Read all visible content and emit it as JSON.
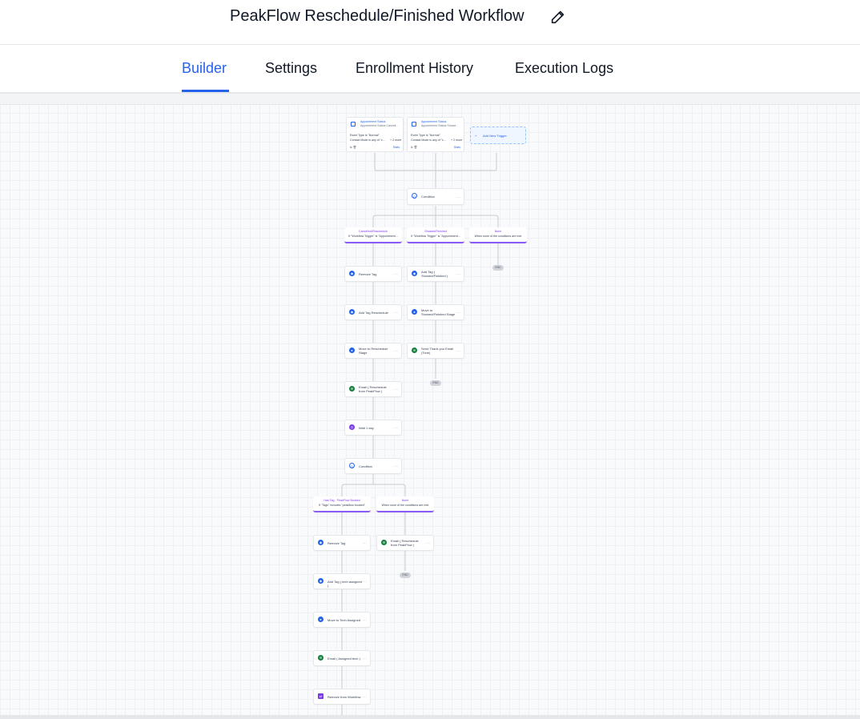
{
  "header": {
    "title": "PeakFlow Reschedule/Finished Workflow",
    "edit_icon": "pencil-icon"
  },
  "tabs": [
    {
      "label": "Builder",
      "active": true
    },
    {
      "label": "Settings",
      "active": false
    },
    {
      "label": "Enrollment History",
      "active": false
    },
    {
      "label": "Execution Logs",
      "active": false
    }
  ],
  "colors": {
    "accent": "#2563eb",
    "branch": "#8b5cf6",
    "email": "#15803d"
  },
  "triggers": [
    {
      "title": "Appointment Status",
      "subtitle": "Appointment Status Cancell...",
      "line1": "Event Type is \"Normal\"",
      "line2": "Contact Mode is any of \"c...",
      "more": "+ 2 more",
      "stats": "Stats"
    },
    {
      "title": "Appointment Status",
      "subtitle": "Appointment Status Showe...",
      "line1": "Event Type is \"Normal\"",
      "line2": "Contact Mode is any of \"c...",
      "more": "+ 2 more",
      "stats": "Stats"
    }
  ],
  "add_trigger": "Add New Trigger",
  "conditions": {
    "first": "Condition",
    "second": "Condition"
  },
  "branches": {
    "cancelled": {
      "title": "Cancelled/Reschedule",
      "desc": "If \"Workflow Trigger\" is \"Appointment..."
    },
    "showed": {
      "title": "Showed/Finished",
      "desc": "If \"Workflow Trigger\" is \"Appointment..."
    },
    "none1": {
      "title": "None",
      "desc": "When none of the conditions are met"
    },
    "has_tag": {
      "title": "Has Tag - PeakFlow Booked",
      "desc": "If \"Tags\" includes \"peakflow booked\""
    },
    "none2": {
      "title": "None",
      "desc": "When none of the conditions are met"
    }
  },
  "actions": {
    "remove_tag_1": "Remove Tag",
    "add_tag_reschedule": "Add Tag Reschedule",
    "move_reschedule": "Move to Reschedule Stage",
    "email_reschedule": "Email ( Reschedule from PeakFlow )",
    "wait": "Wait 1 day",
    "add_tag_showed": "Add Tag ( Showed/Finished )",
    "move_showed": "Move to Showed/Finished Stage",
    "send_thankyou": "Send Thank you Email (Tone)",
    "remove_tag_2": "Remove Tag",
    "add_tag_tech": "Add Tag ( tech assigned )",
    "move_tech": "Move to Tech Assigned",
    "email_assigned": "Email ( Assigned tech )",
    "remove_workflow": "Remove from Workflow",
    "email_reschedule_2": "Email ( Reschedule from PeakFlow )"
  },
  "end_label": "END"
}
